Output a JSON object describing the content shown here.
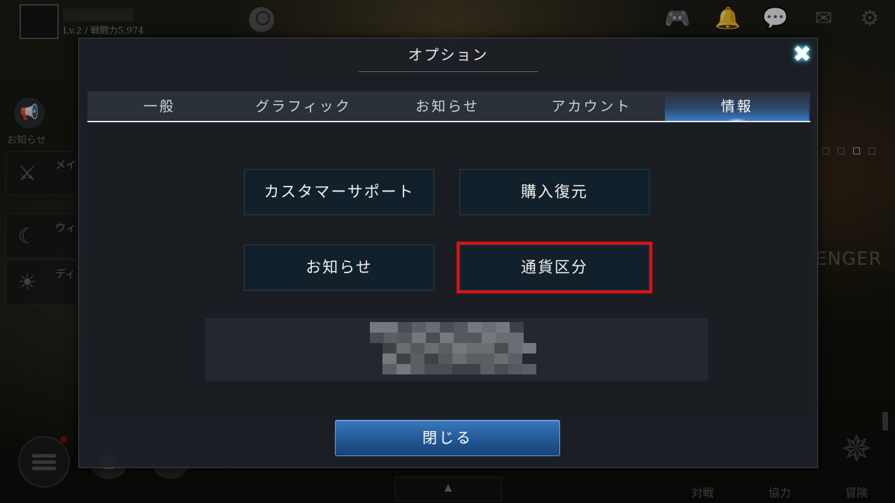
{
  "hud": {
    "player_level": "Lv.2 / 戦闘力5,974",
    "icons": [
      "gamepad-icon",
      "bell-icon",
      "chat-icon",
      "mail-icon",
      "gear-icon"
    ]
  },
  "side_panel": {
    "notice_label": "お知らせ",
    "items": [
      {
        "icon": "sword-icon",
        "text": "メイ完了"
      },
      {
        "icon": "moon-icon",
        "text": "ウィりま"
      },
      {
        "icon": "sun-icon",
        "text": "ディ"
      }
    ]
  },
  "bottom_nav": {
    "items": [
      {
        "icon": "compass-icon",
        "label": "対戦"
      },
      {
        "icon": "compass-icon",
        "label": "協力"
      },
      {
        "icon": "compass-icon",
        "label": "冒険"
      }
    ],
    "expand_glyph": "▲"
  },
  "background_text": "ENGER",
  "dialog": {
    "title": "オプション",
    "close_glyph": "✖",
    "tabs": [
      {
        "label": "一般",
        "active": false
      },
      {
        "label": "グラフィック",
        "active": false
      },
      {
        "label": "お知らせ",
        "active": false
      },
      {
        "label": "アカウント",
        "active": false
      },
      {
        "label": "情報",
        "active": true
      }
    ],
    "buttons": {
      "customer_support": "カスタマーサポート",
      "purchase_restore": "購入復元",
      "notice": "お知らせ",
      "currency_category": "通貨区分"
    },
    "close_button": "閉じる"
  },
  "colors": {
    "highlight_frame": "#e30e0e",
    "active_tab": "#3d7ac4",
    "close_button": "#215591"
  }
}
